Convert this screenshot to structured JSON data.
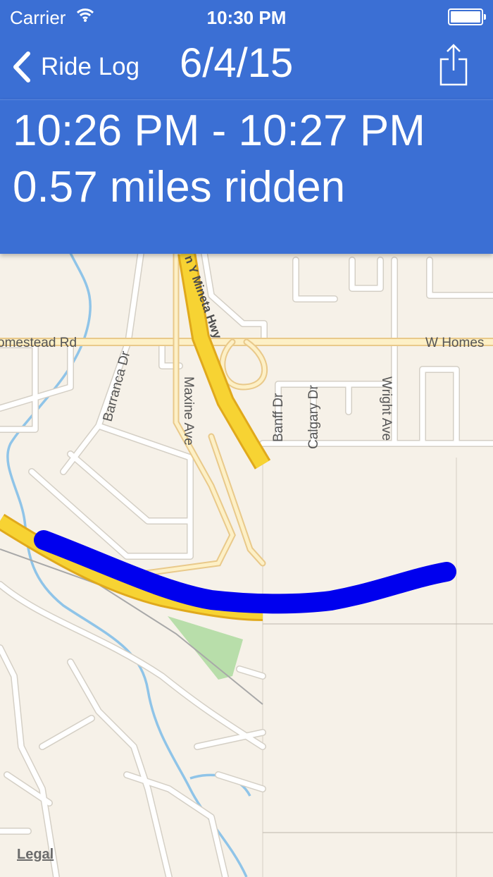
{
  "status_bar": {
    "carrier": "Carrier",
    "time": "10:30 PM"
  },
  "nav": {
    "back_label": "Ride Log",
    "title": "6/4/15"
  },
  "ride": {
    "time_range": "10:26 PM - 10:27 PM",
    "distance": "0.57 miles ridden"
  },
  "map": {
    "labels": {
      "homestead_left": "omestead Rd",
      "homestead_right": "W Homes",
      "highway": "n Y Mineta Hwy",
      "barranca": "Barranca Dr",
      "maxine": "Maxine Ave",
      "banff": "Banff Dr",
      "calgary": "Calgary Dr",
      "wright": "Wright Ave"
    },
    "legal": "Legal",
    "route_color": "#0000ee"
  },
  "colors": {
    "accent": "#3b6fd4",
    "map_bg": "#f6f1e8",
    "highway": "#f7d333"
  }
}
